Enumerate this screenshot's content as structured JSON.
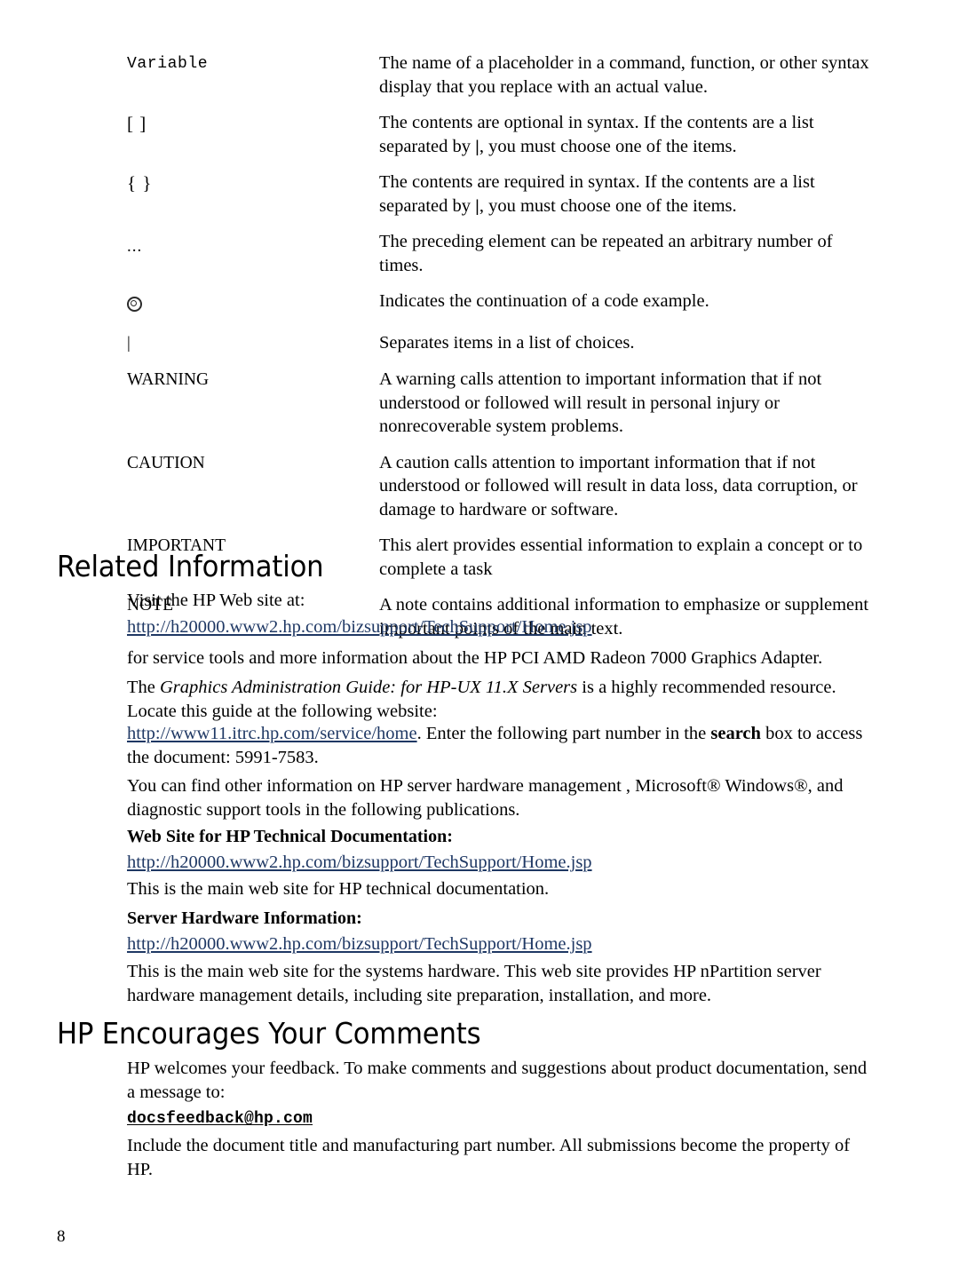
{
  "document": {
    "page_number": "8"
  },
  "conventions": {
    "rows": [
      {
        "term": "Variable",
        "term_style": "mono",
        "description": "The name of a placeholder in a command, function, or other syntax display that you replace with an actual value."
      },
      {
        "term": "[ ]",
        "term_style": "bracket",
        "desc_part1": "The contents are optional in syntax. If the contents are a list separated by ",
        "desc_pipe": "|",
        "desc_part2": ", you must choose one of the items."
      },
      {
        "term": "{ }",
        "term_style": "bracket",
        "desc_part1": "The contents are required in syntax. If the contents are a list separated by ",
        "desc_pipe": "|",
        "desc_part2": ", you must choose one of the items."
      },
      {
        "term": "...",
        "term_style": "dots",
        "description": "The preceding element can be repeated an arbitrary number of times."
      },
      {
        "term": "",
        "term_style": "spiral",
        "description": "Indicates the continuation of a code example."
      },
      {
        "term": "|",
        "term_style": "pipe",
        "description": "Separates items in a list of choices."
      },
      {
        "term": "WARNING",
        "term_style": "caps",
        "description": "A warning calls attention to important information that if not understood or followed will result in personal injury or nonrecoverable system problems."
      },
      {
        "term": "CAUTION",
        "term_style": "caps",
        "description": "A caution calls attention to important information that if not understood or followed will result in data loss, data corruption, or damage to hardware or software."
      },
      {
        "term": "IMPORTANT",
        "term_style": "caps",
        "description": "This alert provides essential information to explain a concept or to complete a task"
      },
      {
        "term": "NOTE",
        "term_style": "caps",
        "description": "A note contains additional information to emphasize or supplement important points of the main text."
      }
    ]
  },
  "related_information": {
    "heading": "Related Information",
    "intro": "Visit the HP Web site at:",
    "link_main": "http://h20000.www2.hp.com/bizsupport/TechSupport/Home.jsp",
    "after_link": "for service tools and more information about the HP PCI AMD Radeon 7000 Graphics Adapter.",
    "guide_prefix": "The ",
    "guide_title": "Graphics Administration Guide: for HP-UX 11.X Servers",
    "guide_suffix": " is a highly recommended resource. Locate this guide at the following website:",
    "itrc_link": "http://www11.itrc.hp.com/service/home",
    "itrc_after_1": ". Enter the following part number in the ",
    "itrc_search_word": "search",
    "itrc_after_2": " box to access the document: 5991-7583.",
    "other_info": "You can find other information on HP server hardware management , Microsoft® Windows®, and diagnostic support tools in the following publications.",
    "subhead_webdoc": "Web Site for HP Technical Documentation:",
    "link_webdoc": "http://h20000.www2.hp.com/bizsupport/TechSupport/Home.jsp",
    "webdoc_desc": "This is the main web site for HP technical documentation.",
    "subhead_serverhw": "Server Hardware Information:",
    "link_serverhw": "http://h20000.www2.hp.com/bizsupport/TechSupport/Home.jsp",
    "serverhw_desc": "This is the main web site for the systems hardware. This web site provides HP nPartition server hardware management details, including site preparation, installation, and more."
  },
  "comments": {
    "heading": "HP Encourages Your Comments",
    "intro": "HP welcomes your feedback. To make comments and suggestions about product documentation, send a message to:",
    "email": "docsfeedback@hp.com",
    "outro": "Include the document title and manufacturing part number. All submissions become the property of HP."
  },
  "colors": {
    "link": "#1f3864",
    "text": "#000000",
    "background": "#ffffff"
  }
}
